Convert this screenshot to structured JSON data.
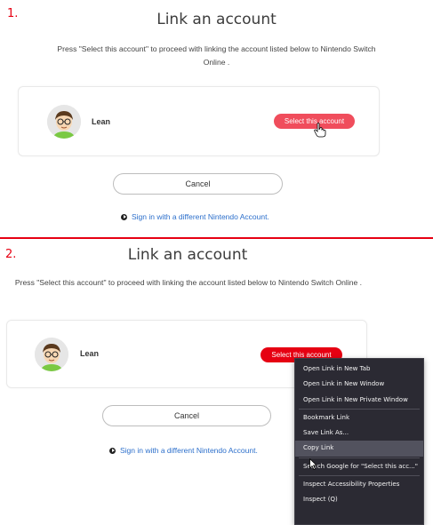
{
  "steps": [
    {
      "number": "1.",
      "title": "Link an account",
      "description": "Press \"Select this account\" to proceed with linking the account listed below to Nintendo Switch Online .",
      "account_name": "Lean",
      "select_label": "Select this account",
      "cancel_label": "Cancel",
      "alt_link": "Sign in with a different Nintendo Account."
    },
    {
      "number": "2.",
      "title": "Link an account",
      "description": "Press \"Select this account\" to proceed with linking the account listed below to Nintendo Switch Online .",
      "account_name": "Lean",
      "select_label": "Select this account",
      "cancel_label": "Cancel",
      "alt_link": "Sign in with a different Nintendo Account."
    }
  ],
  "context_menu": {
    "items": [
      "Open Link in New Tab",
      "Open Link in New Window",
      "Open Link in New Private Window",
      "Bookmark Link",
      "Save Link As...",
      "Copy Link",
      "Search Google for \"Select this acc...\"",
      "Inspect Accessibility Properties",
      "Inspect (Q)"
    ],
    "highlighted": "Copy Link"
  },
  "colors": {
    "accent_red": "#e60012",
    "select_button_hover": "#f04d5c",
    "link_blue": "#2c6fcb",
    "menu_bg": "#2b2a33"
  },
  "icons": {
    "avatar": "mii-avatar-icon",
    "link_bullet": "arrow-circle-icon",
    "cursor_hand": "hand-pointer-icon",
    "cursor_arrow": "arrow-cursor-icon"
  }
}
